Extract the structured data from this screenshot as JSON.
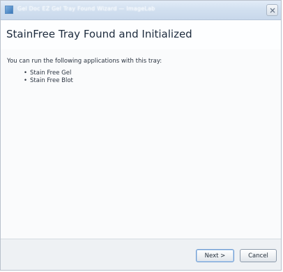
{
  "window": {
    "title": "Gel Doc EZ Gel Tray Found Wizard — ImageLab"
  },
  "header": {
    "title": "StainFree Tray Found and Initialized"
  },
  "content": {
    "intro": "You can run the following applications with this tray:",
    "bullet": "•",
    "applications": [
      "Stain Free Gel",
      "Stain Free Blot"
    ]
  },
  "footer": {
    "next_label": "Next >",
    "cancel_label": "Cancel"
  },
  "icons": {
    "app": "wizard-app-icon",
    "close": "close-icon"
  },
  "colors": {
    "titlebar": "#d2e0f0",
    "title_text": "#1c2a3c",
    "footer_bg": "#eef1f4"
  }
}
